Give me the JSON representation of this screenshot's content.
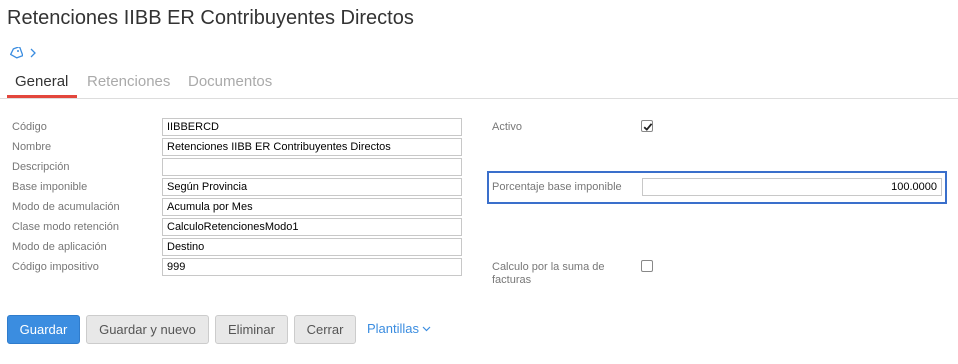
{
  "page": {
    "title": "Retenciones IIBB ER Contribuyentes Directos"
  },
  "tabs": [
    {
      "label": "General",
      "active": true
    },
    {
      "label": "Retenciones",
      "active": false
    },
    {
      "label": "Documentos",
      "active": false
    }
  ],
  "form": {
    "codigo": {
      "label": "Código",
      "value": "IIBBERCD"
    },
    "nombre": {
      "label": "Nombre",
      "value": "Retenciones IIBB ER Contribuyentes Directos"
    },
    "descripcion": {
      "label": "Descripción",
      "value": ""
    },
    "base_imponible": {
      "label": "Base imponible",
      "value": "Según Provincia"
    },
    "modo_acumulacion": {
      "label": "Modo de acumulación",
      "value": "Acumula por Mes"
    },
    "clase_modo_retencion": {
      "label": "Clase modo retención",
      "value": "CalculoRetencionesModo1"
    },
    "modo_aplicacion": {
      "label": "Modo de aplicación",
      "value": "Destino"
    },
    "codigo_impositivo": {
      "label": "Código impositivo",
      "value": "999"
    },
    "activo": {
      "label": "Activo",
      "checked": true
    },
    "porcentaje_base_imponible": {
      "label": "Porcentaje base imponible",
      "value": "100.0000"
    },
    "calculo_suma_facturas": {
      "label_line1": "Calculo por la suma de",
      "label_line2": "facturas",
      "checked": false
    }
  },
  "actions": {
    "save": "Guardar",
    "save_and_new": "Guardar y nuevo",
    "delete": "Eliminar",
    "close": "Cerrar",
    "templates": "Plantillas"
  },
  "colors": {
    "primary": "#3b8de0",
    "tab_accent": "#e3463c",
    "highlight": "#3a6fcb"
  },
  "icons": {
    "tag": "tag-icon",
    "breadcrumb": "chevron-right-icon",
    "dropdown": "chevron-down-icon"
  }
}
